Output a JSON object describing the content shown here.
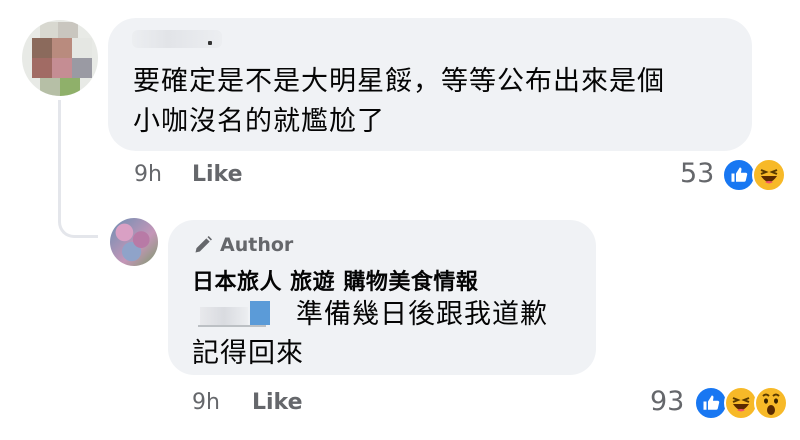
{
  "comment1": {
    "text_line1": "要確定是不是大明星餒，等等公布出來是個",
    "text_line2": "小咖沒名的就尷尬了",
    "time": "9h",
    "like_label": "Like",
    "reaction_count": "53",
    "reactions": [
      "like-icon",
      "haha-icon"
    ]
  },
  "reply": {
    "badge_label": "Author",
    "badge_icon": "pencil-icon",
    "page_name": "日本旅人  旅遊  購物美食情報",
    "text_line1": "準備幾日後跟我道歉",
    "text_line2": "記得回來",
    "time": "9h",
    "like_label": "Like",
    "reaction_count": "93",
    "reactions": [
      "like-icon",
      "haha-icon",
      "wow-icon"
    ]
  },
  "colors": {
    "bubble": "#f0f2f5",
    "meta_text": "#65676b",
    "like_blue": "#1877f2",
    "emoji_yellow": "#f7b928"
  }
}
